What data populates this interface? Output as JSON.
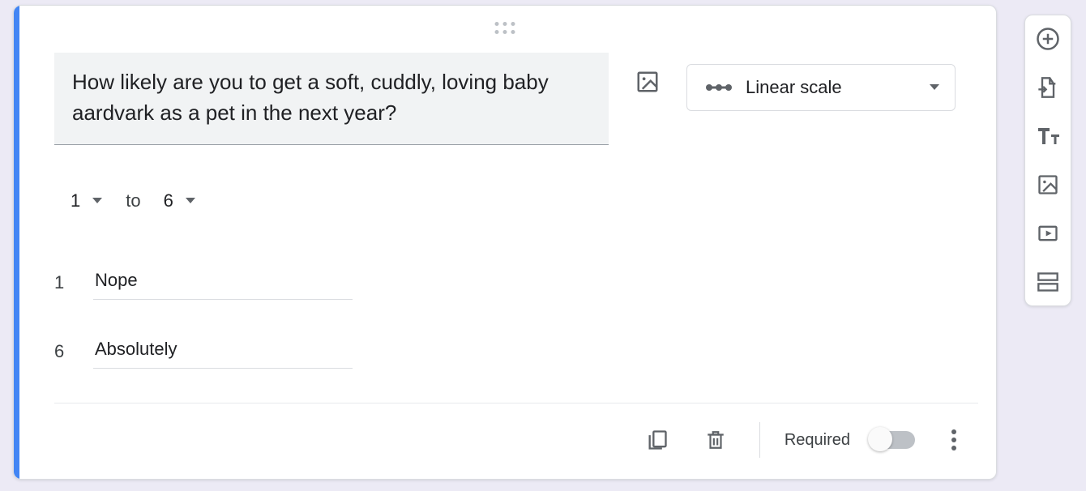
{
  "question": {
    "text": "How likely are you to get a soft, cuddly, loving baby aardvark as a pet in the next year?",
    "type_label": "Linear scale"
  },
  "scale": {
    "from": "1",
    "to_word": "to",
    "to": "6"
  },
  "labels": {
    "low_num": "1",
    "low_text": "Nope",
    "high_num": "6",
    "high_text": "Absolutely"
  },
  "footer": {
    "required_label": "Required"
  }
}
